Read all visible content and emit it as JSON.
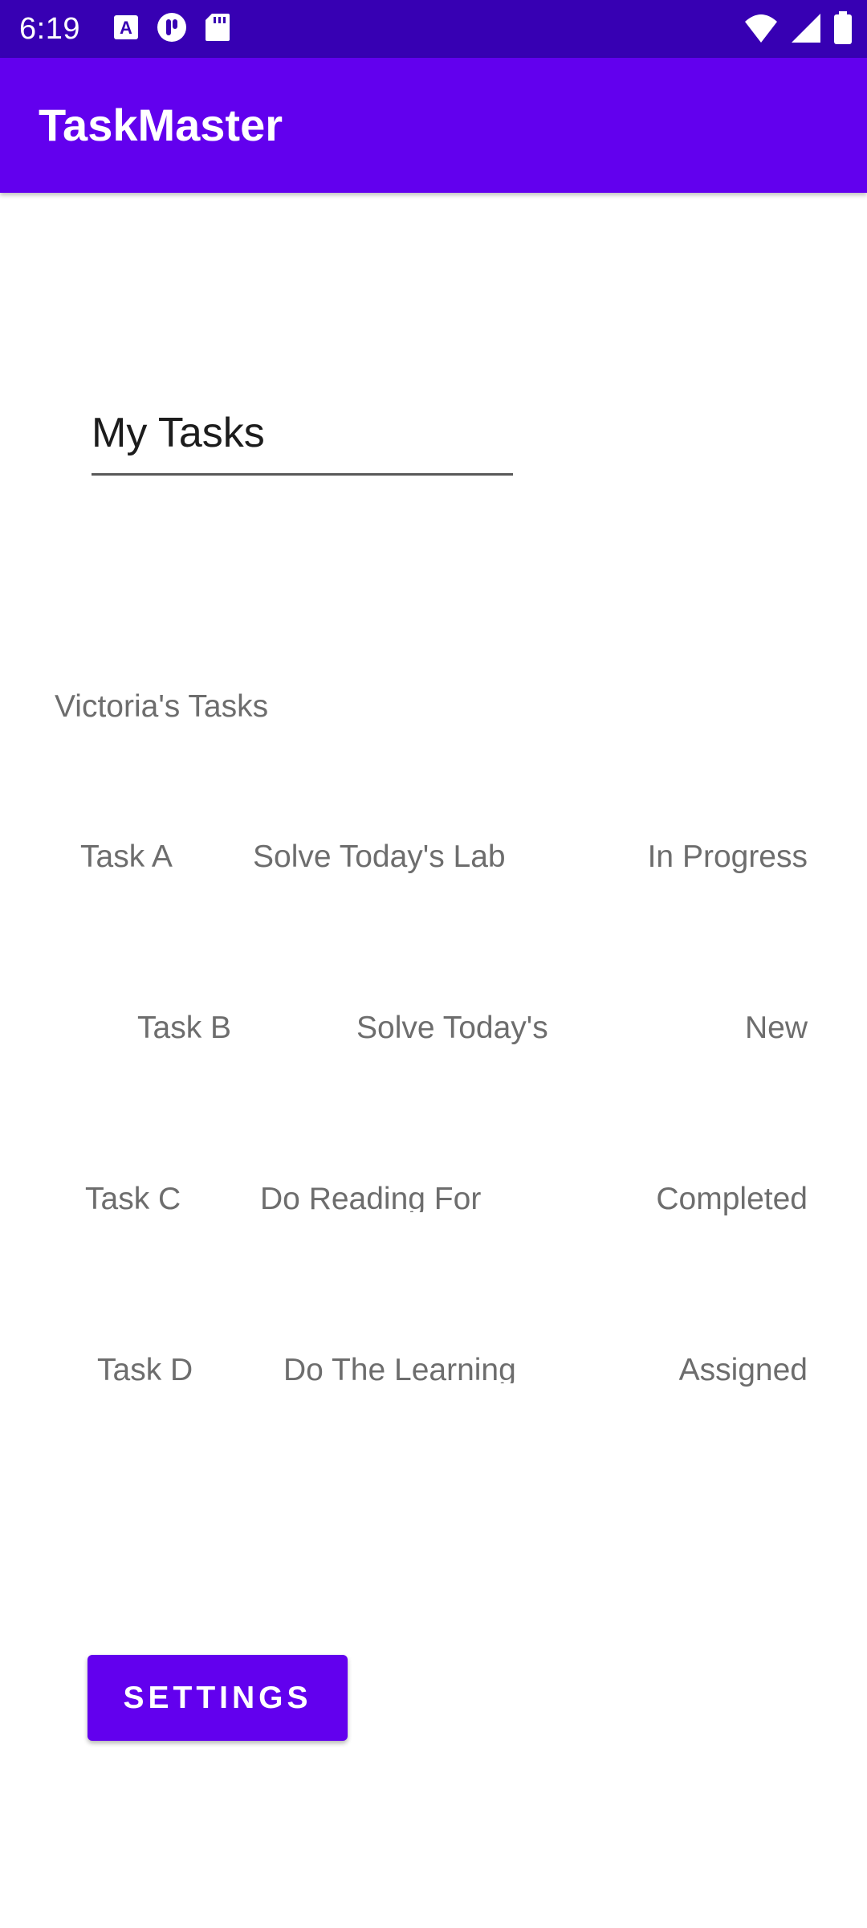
{
  "status_bar": {
    "time": "6:19",
    "icons_left": [
      "a-box-icon",
      "podcast-icon",
      "sd-card-icon"
    ],
    "icons_right": [
      "wifi-icon",
      "signal-icon",
      "battery-icon"
    ]
  },
  "app_bar": {
    "title": "TaskMaster"
  },
  "main": {
    "my_tasks_value": "My Tasks",
    "user_tasks_title": "Victoria's Tasks",
    "tasks": [
      {
        "name": "Task A",
        "description": "Solve Today's Lab",
        "status": "In Progress"
      },
      {
        "name": "Task B",
        "description": "Solve Today's",
        "status": "New"
      },
      {
        "name": "Task C",
        "description": "Do Reading For",
        "status": "Completed"
      },
      {
        "name": "Task D",
        "description": "Do The Learning",
        "status": "Assigned"
      }
    ],
    "settings_label": "SETTINGS"
  },
  "colors": {
    "status_bar": "#3700b3",
    "primary": "#6200ee",
    "muted_text": "#6d6d6d"
  }
}
